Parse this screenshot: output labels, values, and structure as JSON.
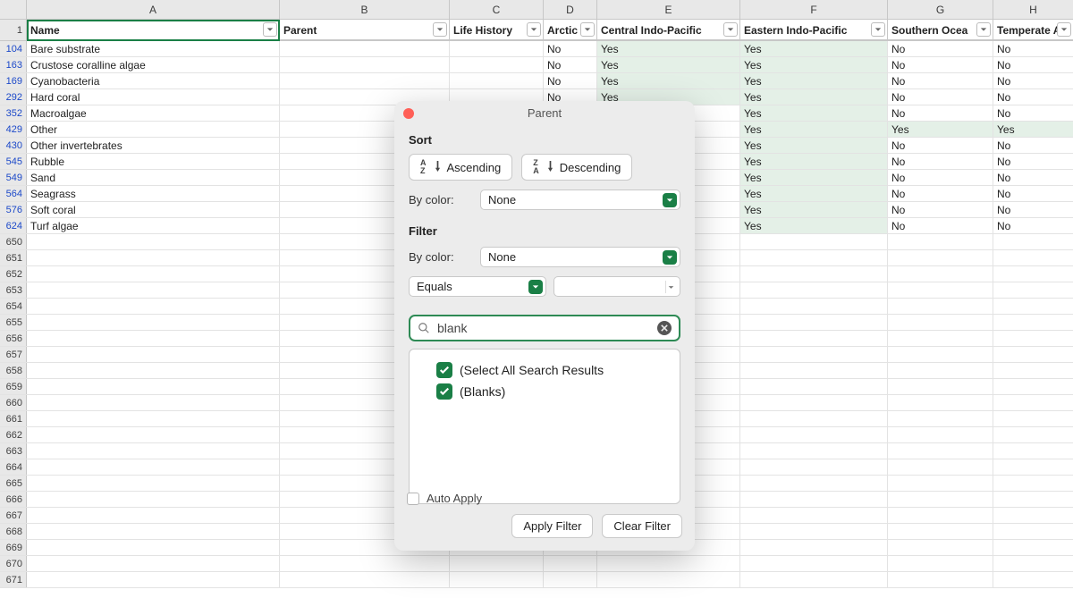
{
  "columns": [
    "A",
    "B",
    "C",
    "D",
    "E",
    "F",
    "G",
    "H"
  ],
  "header_row_index": 1,
  "headers": {
    "A": "Name",
    "B": "Parent",
    "C": "Life History",
    "D": "Arctic",
    "E": "Central Indo-Pacific",
    "F": "Eastern Indo-Pacific",
    "G": "Southern Ocea",
    "H": "Temperate A"
  },
  "data_rows": [
    {
      "n": 104,
      "A": "Bare substrate",
      "D": "No",
      "E": "Yes",
      "F": "Yes",
      "G": "No",
      "H": "No"
    },
    {
      "n": 163,
      "A": "Crustose coralline algae",
      "D": "No",
      "E": "Yes",
      "F": "Yes",
      "G": "No",
      "H": "No"
    },
    {
      "n": 169,
      "A": "Cyanobacteria",
      "D": "No",
      "E": "Yes",
      "F": "Yes",
      "G": "No",
      "H": "No"
    },
    {
      "n": 292,
      "A": "Hard coral",
      "D": "No",
      "E": "Yes",
      "F": "Yes",
      "G": "No",
      "H": "No"
    },
    {
      "n": 352,
      "A": "Macroalgae",
      "D": "",
      "E": "",
      "F": "Yes",
      "G": "No",
      "H": "No"
    },
    {
      "n": 429,
      "A": "Other",
      "D": "",
      "E": "",
      "F": "Yes",
      "G": "Yes",
      "H": "Yes"
    },
    {
      "n": 430,
      "A": "Other invertebrates",
      "D": "",
      "E": "",
      "F": "Yes",
      "G": "No",
      "H": "No"
    },
    {
      "n": 545,
      "A": "Rubble",
      "D": "",
      "E": "",
      "F": "Yes",
      "G": "No",
      "H": "No"
    },
    {
      "n": 549,
      "A": "Sand",
      "D": "",
      "E": "",
      "F": "Yes",
      "G": "No",
      "H": "No"
    },
    {
      "n": 564,
      "A": "Seagrass",
      "D": "",
      "E": "",
      "F": "Yes",
      "G": "No",
      "H": "No"
    },
    {
      "n": 576,
      "A": "Soft coral",
      "D": "",
      "E": "",
      "F": "Yes",
      "G": "No",
      "H": "No"
    },
    {
      "n": 624,
      "A": "Turf algae",
      "D": "",
      "E": "",
      "F": "Yes",
      "G": "No",
      "H": "No"
    }
  ],
  "empty_rows": [
    650,
    651,
    652,
    653,
    654,
    655,
    656,
    657,
    658,
    659,
    660,
    661,
    662,
    663,
    664,
    665,
    666,
    667,
    668,
    669,
    670,
    671
  ],
  "popover": {
    "title": "Parent",
    "sort_label": "Sort",
    "ascending": "Ascending",
    "descending": "Descending",
    "by_color": "By color:",
    "none": "None",
    "filter_label": "Filter",
    "cond": "Equals",
    "cond_value": "",
    "search_value": "blank",
    "select_all": "(Select All Search Results",
    "blanks": "(Blanks)",
    "auto_apply": "Auto Apply",
    "apply": "Apply Filter",
    "clear": "Clear Filter"
  }
}
